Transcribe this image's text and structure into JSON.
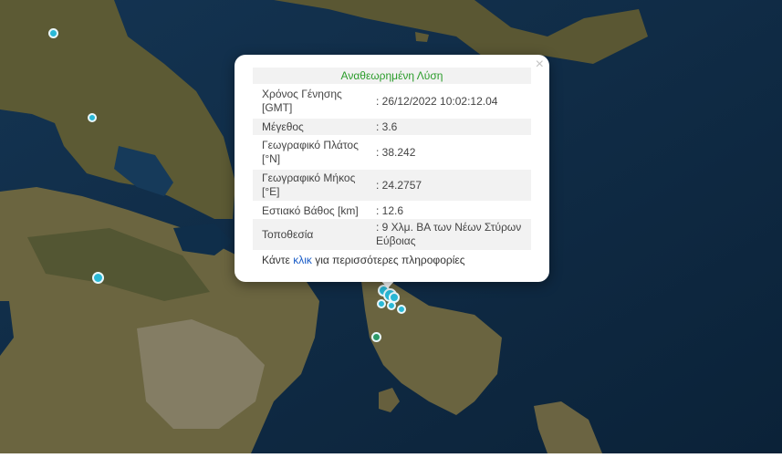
{
  "popup": {
    "title": "Αναθεωρημένη Λύση",
    "close": "×",
    "rows": [
      {
        "label": "Χρόνος Γένησης [GMT]",
        "value": ": 26/12/2022 10:02:12.04"
      },
      {
        "label": "Μέγεθος",
        "value": ": 3.6"
      },
      {
        "label": "Γεωγραφικό Πλάτος [°N]",
        "value": ": 38.242"
      },
      {
        "label": "Γεωγραφικό Μήκος [°E]",
        "value": ": 24.2757"
      },
      {
        "label": "Εστιακό Βάθος [km]",
        "value": ": 12.6"
      },
      {
        "label": "Τοποθεσία",
        "value": ": 9 Χλμ. ΒΑ των Νέων Στύρων Εύβοιας"
      }
    ],
    "footer": {
      "before": "Κάντε ",
      "link": "κλικ",
      "after": " για περισσότερες πληροφορίες"
    }
  },
  "colors": {
    "marker_cyan": "#29b8d6",
    "marker_green": "#2e9a6a",
    "sea": "#0e2a44",
    "land": "#5e5a33"
  }
}
